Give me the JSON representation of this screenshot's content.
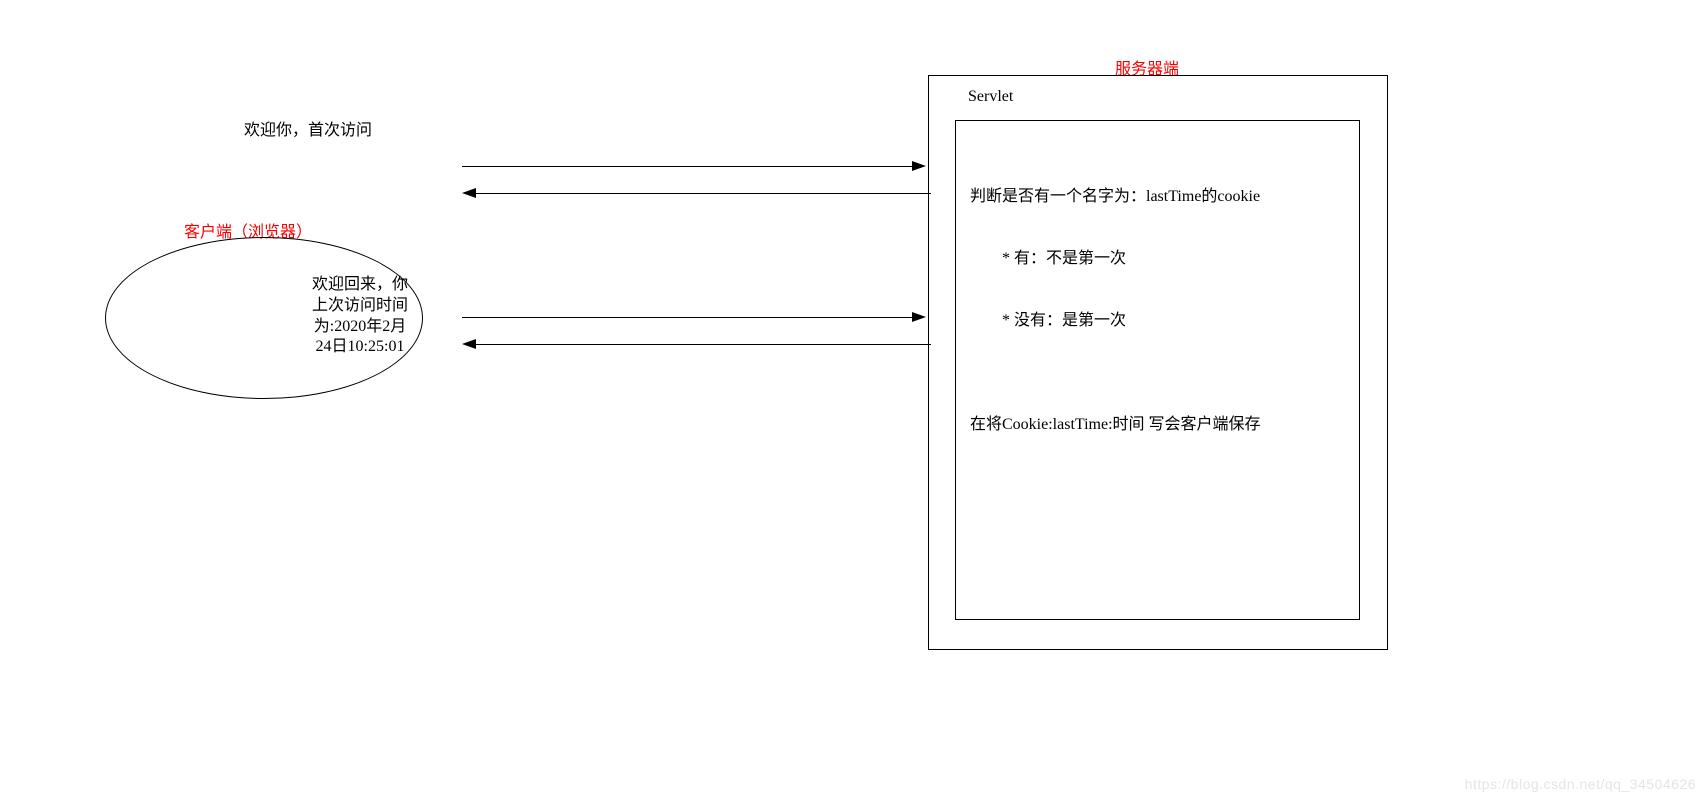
{
  "labels": {
    "client": "客户端（浏览器）",
    "server": "服务器端",
    "servlet": "Servlet"
  },
  "messages": {
    "firstVisit": "欢迎你，首次访问",
    "welcomeBack1": "欢迎回来，你",
    "welcomeBack2": "上次访问时间",
    "welcomeBack3": "为:2020年2月",
    "welcomeBack4": "24日10:25:01"
  },
  "servletLogic": {
    "line1": "判断是否有一个名字为：lastTime的cookie",
    "line2": "        * 有：不是第一次",
    "line3": "        * 没有：是第一次",
    "line4": "",
    "line5": "在将Cookie:lastTime:时间 写会客户端保存"
  },
  "watermark": "https://blog.csdn.net/qq_34504626"
}
